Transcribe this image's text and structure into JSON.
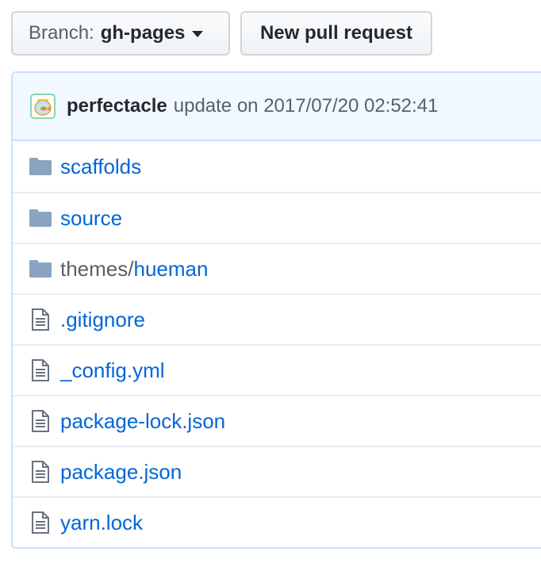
{
  "toolbar": {
    "branch_prefix": "Branch:",
    "branch_name": "gh-pages",
    "new_pr_label": "New pull request"
  },
  "commit": {
    "author": "perfectacle",
    "message": "update on 2017/07/20 02:52:41"
  },
  "files": [
    {
      "name": "scaffolds",
      "type": "folder"
    },
    {
      "name": "source",
      "type": "folder"
    },
    {
      "name": "themes/",
      "name_link": "hueman",
      "type": "submodule"
    },
    {
      "name": ".gitignore",
      "type": "file"
    },
    {
      "name": "_config.yml",
      "type": "file"
    },
    {
      "name": "package-lock.json",
      "type": "file"
    },
    {
      "name": "package.json",
      "type": "file"
    },
    {
      "name": "yarn.lock",
      "type": "file"
    }
  ],
  "colors": {
    "link": "#0366d6",
    "folder_icon": "#79b8ff",
    "commit_bg": "#f1f8ff",
    "commit_border": "#c8e1ff"
  }
}
